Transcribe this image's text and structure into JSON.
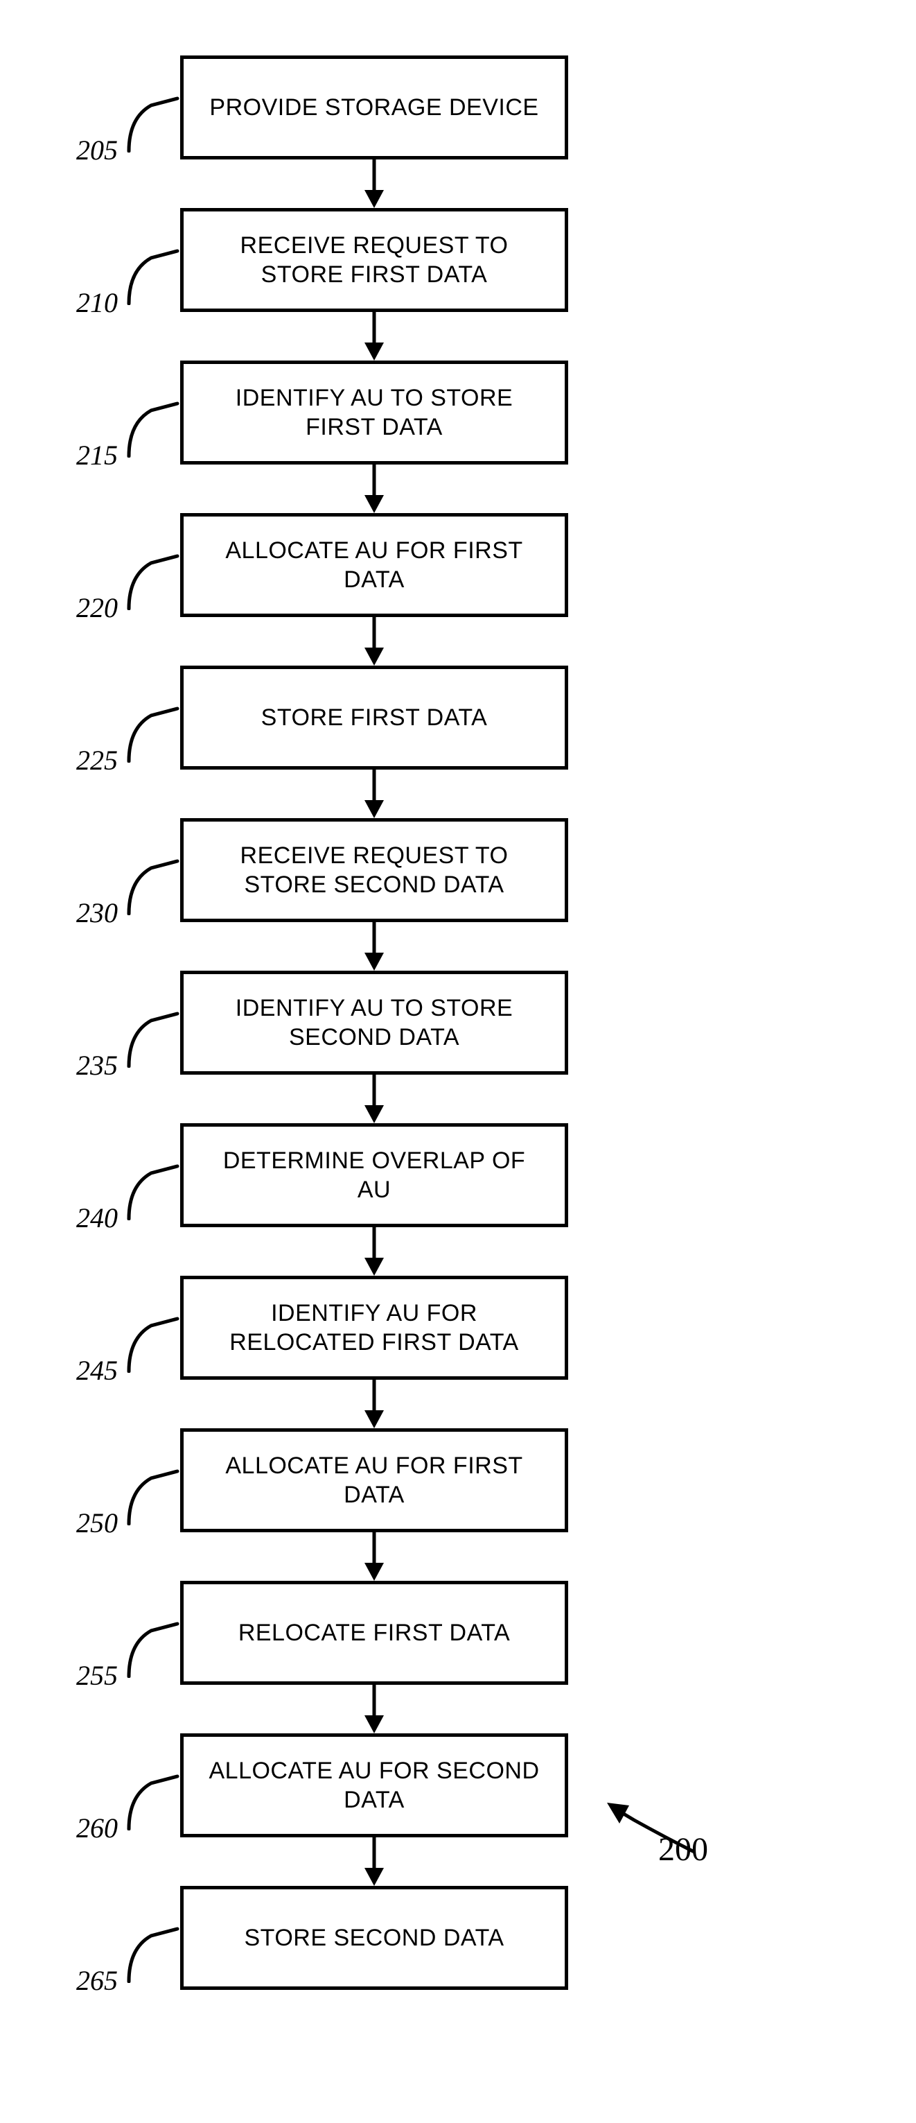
{
  "chart_data": {
    "type": "flowchart",
    "title": "",
    "figure_ref": "200",
    "steps": [
      {
        "ref": "205",
        "label": "PROVIDE STORAGE DEVICE"
      },
      {
        "ref": "210",
        "label": "RECEIVE REQUEST TO STORE FIRST DATA"
      },
      {
        "ref": "215",
        "label": "IDENTIFY AU TO STORE FIRST DATA"
      },
      {
        "ref": "220",
        "label": "ALLOCATE AU FOR FIRST DATA"
      },
      {
        "ref": "225",
        "label": "STORE FIRST DATA"
      },
      {
        "ref": "230",
        "label": "RECEIVE REQUEST TO STORE SECOND DATA"
      },
      {
        "ref": "235",
        "label": "IDENTIFY AU TO STORE SECOND DATA"
      },
      {
        "ref": "240",
        "label": "DETERMINE OVERLAP OF AU"
      },
      {
        "ref": "245",
        "label": "IDENTIFY AU FOR RELOCATED FIRST DATA"
      },
      {
        "ref": "250",
        "label": "ALLOCATE AU FOR FIRST DATA"
      },
      {
        "ref": "255",
        "label": "RELOCATE FIRST DATA"
      },
      {
        "ref": "260",
        "label": "ALLOCATE AU FOR SECOND DATA"
      },
      {
        "ref": "265",
        "label": "STORE SECOND DATA"
      }
    ]
  }
}
